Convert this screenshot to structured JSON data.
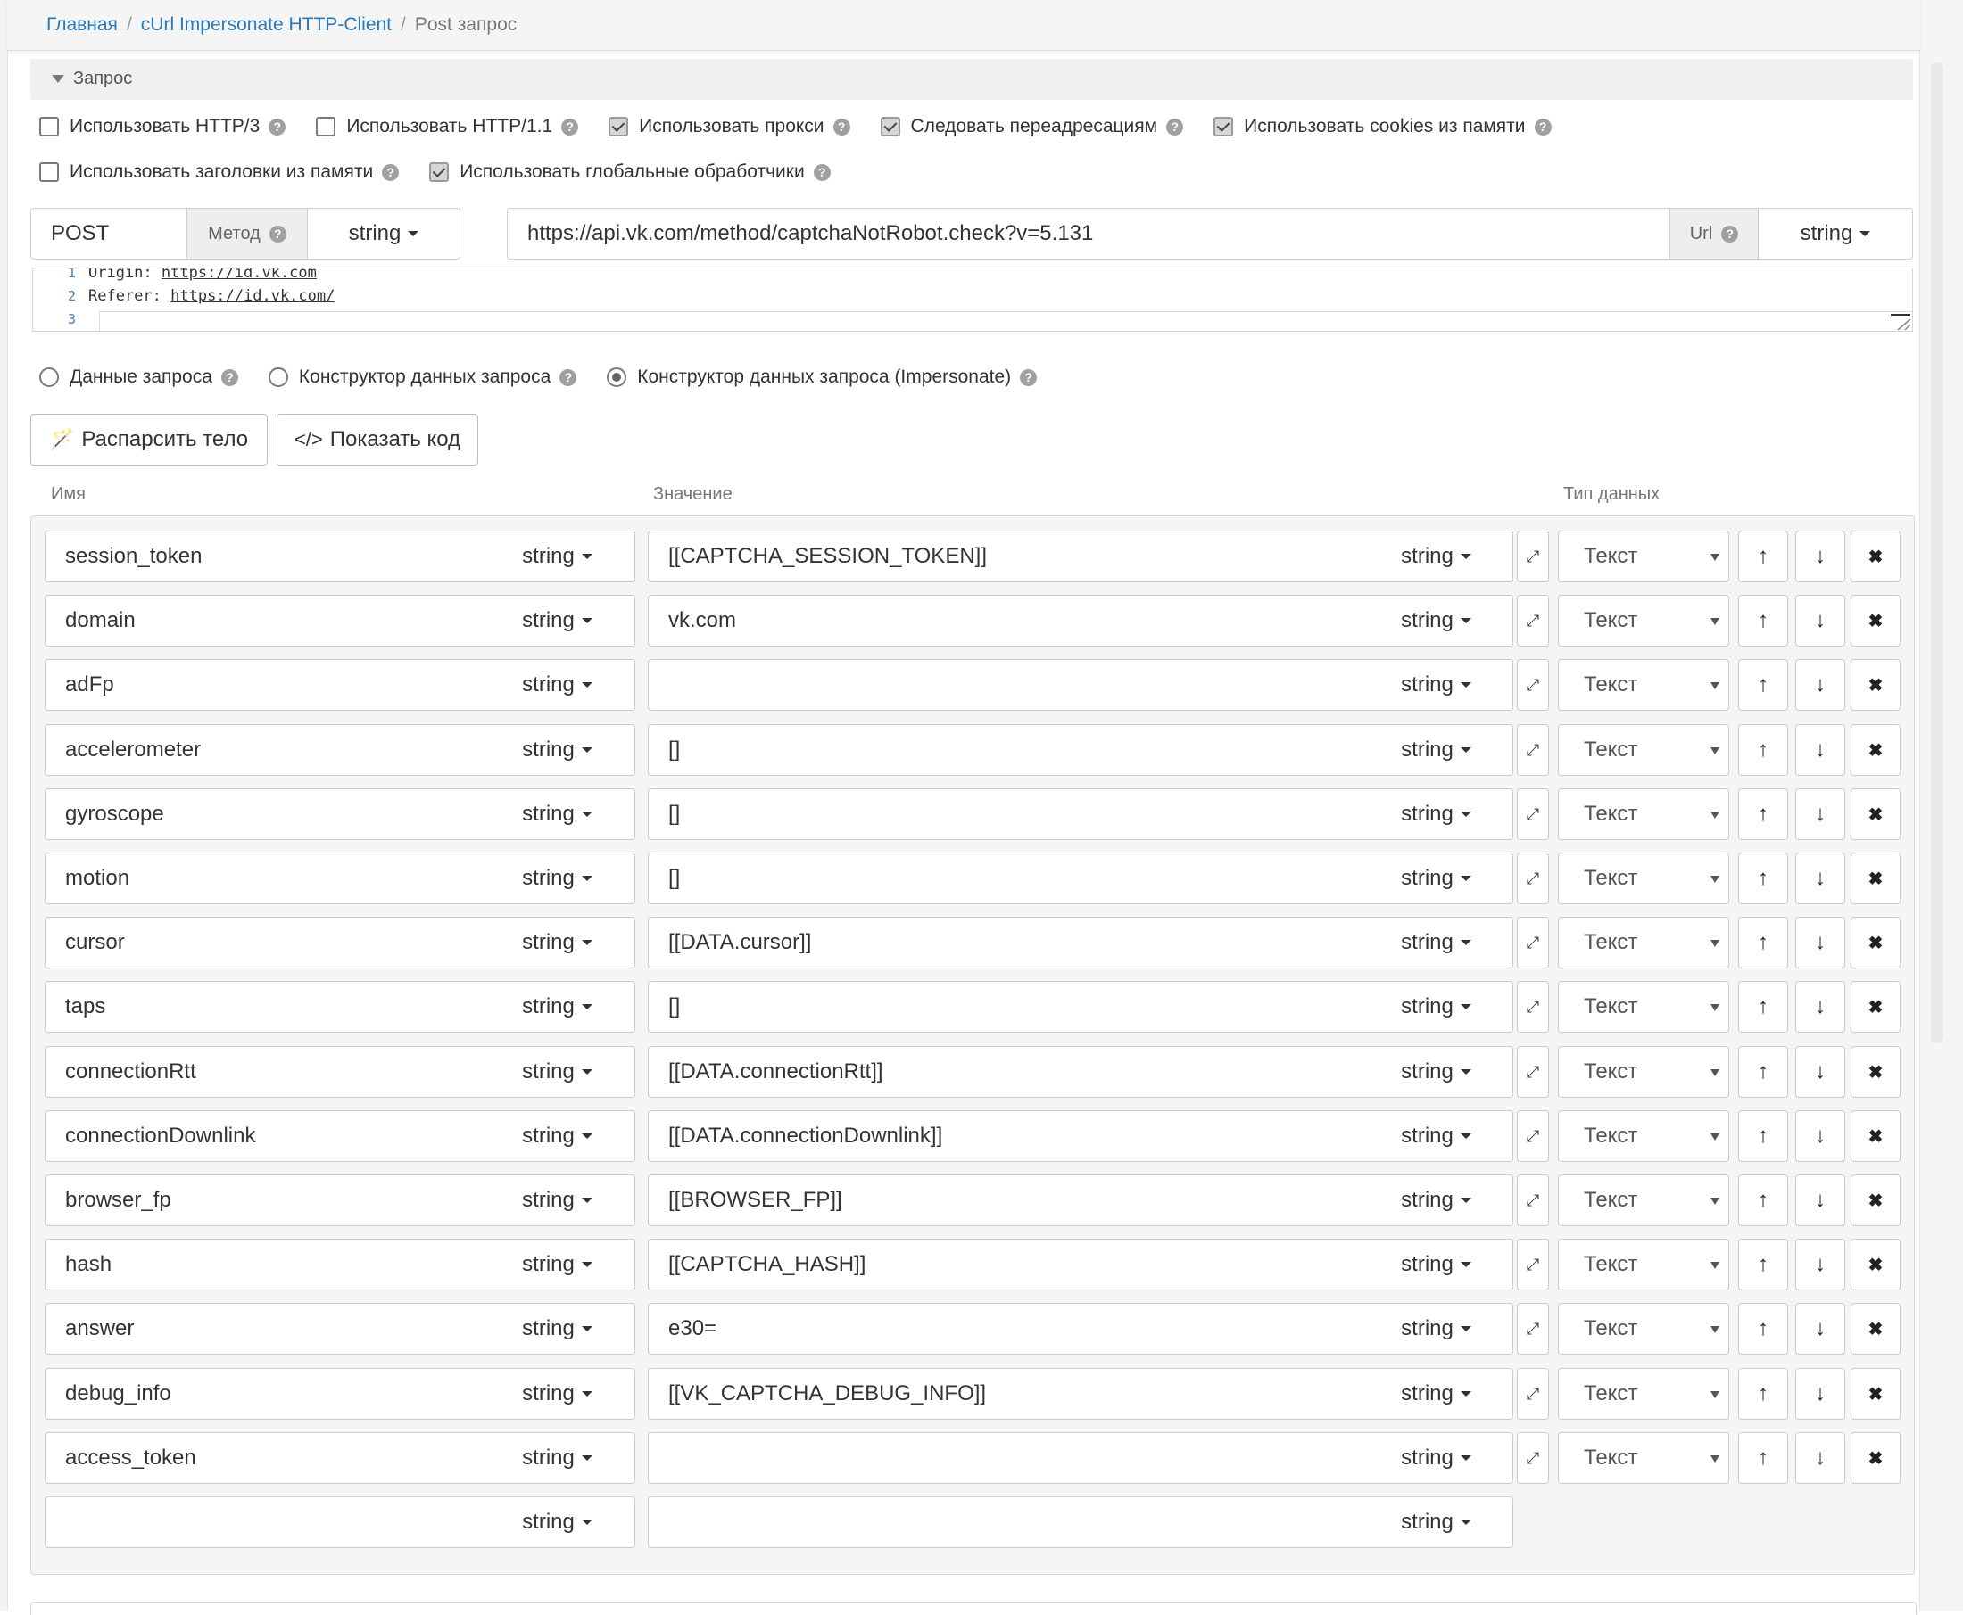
{
  "breadcrumb": {
    "home": "Главная",
    "parent": "cUrl Impersonate HTTP-Client",
    "current": "Post запрос",
    "separator": "/"
  },
  "section": {
    "title": "Запрос"
  },
  "options": [
    {
      "label": "Использовать HTTP/3",
      "checked": false
    },
    {
      "label": "Использовать HTTP/1.1",
      "checked": false
    },
    {
      "label": "Использовать прокси",
      "checked": true
    },
    {
      "label": "Следовать переадресациям",
      "checked": true
    },
    {
      "label": "Использовать cookies из памяти",
      "checked": true
    },
    {
      "label": "Использовать заголовки из памяти",
      "checked": false
    },
    {
      "label": "Использовать глобальные обработчики",
      "checked": true
    }
  ],
  "help_glyph": "?",
  "method": {
    "value": "POST",
    "addon": "Метод",
    "type": "string"
  },
  "url": {
    "value": "https://api.vk.com/method/captchaNotRobot.check?v=5.131",
    "addon": "Url",
    "type": "string"
  },
  "editor": {
    "lines": [
      {
        "n": "1",
        "key": "Origin: ",
        "link": "https://id.vk.com"
      },
      {
        "n": "2",
        "key": "Referer: ",
        "link": "https://id.vk.com/"
      },
      {
        "n": "3",
        "key": "",
        "link": ""
      }
    ]
  },
  "modes": [
    {
      "label": "Данные запроса",
      "selected": false
    },
    {
      "label": "Конструктор данных запроса",
      "selected": false
    },
    {
      "label": "Конструктор данных запроса (Impersonate)",
      "selected": true
    }
  ],
  "buttons": {
    "parse": "Распарсить тело",
    "show_code": "Показать код"
  },
  "columns": {
    "name": "Имя",
    "value": "Значение",
    "type": "Тип данных"
  },
  "row_defaults": {
    "type": "string",
    "data_type": "Текст"
  },
  "icons": {
    "up": "↑",
    "down": "↓",
    "remove": "✖",
    "expand": "⤢"
  },
  "params": [
    {
      "name": "session_token",
      "value": "[[CAPTCHA_SESSION_TOKEN]]"
    },
    {
      "name": "domain",
      "value": "vk.com"
    },
    {
      "name": "adFp",
      "value": ""
    },
    {
      "name": "accelerometer",
      "value": "[]"
    },
    {
      "name": "gyroscope",
      "value": "[]"
    },
    {
      "name": "motion",
      "value": "[]"
    },
    {
      "name": "cursor",
      "value": "[[DATA.cursor]]"
    },
    {
      "name": "taps",
      "value": "[]"
    },
    {
      "name": "connectionRtt",
      "value": "[[DATA.connectionRtt]]"
    },
    {
      "name": "connectionDownlink",
      "value": "[[DATA.connectionDownlink]]"
    },
    {
      "name": "browser_fp",
      "value": "[[BROWSER_FP]]"
    },
    {
      "name": "hash",
      "value": "[[CAPTCHA_HASH]]"
    },
    {
      "name": "answer",
      "value": "e30="
    },
    {
      "name": "debug_info",
      "value": "[[VK_CAPTCHA_DEBUG_INFO]]"
    },
    {
      "name": "access_token",
      "value": ""
    }
  ],
  "new_row": {
    "name": "",
    "value": "",
    "type": "string"
  },
  "colors": {
    "link": "#2a7ab8",
    "panel": "#f5f5f5",
    "border": "#cccccc"
  }
}
